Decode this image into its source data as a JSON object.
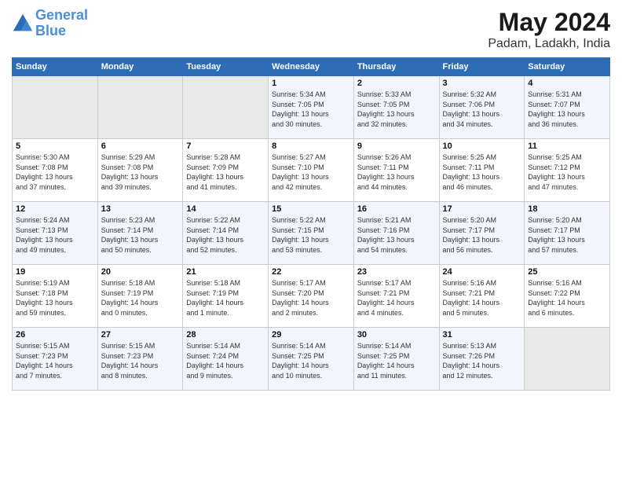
{
  "header": {
    "logo_line1": "General",
    "logo_line2": "Blue",
    "month": "May 2024",
    "location": "Padam, Ladakh, India"
  },
  "days_of_week": [
    "Sunday",
    "Monday",
    "Tuesday",
    "Wednesday",
    "Thursday",
    "Friday",
    "Saturday"
  ],
  "weeks": [
    [
      {
        "day": "",
        "info": ""
      },
      {
        "day": "",
        "info": ""
      },
      {
        "day": "",
        "info": ""
      },
      {
        "day": "1",
        "info": "Sunrise: 5:34 AM\nSunset: 7:05 PM\nDaylight: 13 hours\nand 30 minutes."
      },
      {
        "day": "2",
        "info": "Sunrise: 5:33 AM\nSunset: 7:05 PM\nDaylight: 13 hours\nand 32 minutes."
      },
      {
        "day": "3",
        "info": "Sunrise: 5:32 AM\nSunset: 7:06 PM\nDaylight: 13 hours\nand 34 minutes."
      },
      {
        "day": "4",
        "info": "Sunrise: 5:31 AM\nSunset: 7:07 PM\nDaylight: 13 hours\nand 36 minutes."
      }
    ],
    [
      {
        "day": "5",
        "info": "Sunrise: 5:30 AM\nSunset: 7:08 PM\nDaylight: 13 hours\nand 37 minutes."
      },
      {
        "day": "6",
        "info": "Sunrise: 5:29 AM\nSunset: 7:08 PM\nDaylight: 13 hours\nand 39 minutes."
      },
      {
        "day": "7",
        "info": "Sunrise: 5:28 AM\nSunset: 7:09 PM\nDaylight: 13 hours\nand 41 minutes."
      },
      {
        "day": "8",
        "info": "Sunrise: 5:27 AM\nSunset: 7:10 PM\nDaylight: 13 hours\nand 42 minutes."
      },
      {
        "day": "9",
        "info": "Sunrise: 5:26 AM\nSunset: 7:11 PM\nDaylight: 13 hours\nand 44 minutes."
      },
      {
        "day": "10",
        "info": "Sunrise: 5:25 AM\nSunset: 7:11 PM\nDaylight: 13 hours\nand 46 minutes."
      },
      {
        "day": "11",
        "info": "Sunrise: 5:25 AM\nSunset: 7:12 PM\nDaylight: 13 hours\nand 47 minutes."
      }
    ],
    [
      {
        "day": "12",
        "info": "Sunrise: 5:24 AM\nSunset: 7:13 PM\nDaylight: 13 hours\nand 49 minutes."
      },
      {
        "day": "13",
        "info": "Sunrise: 5:23 AM\nSunset: 7:14 PM\nDaylight: 13 hours\nand 50 minutes."
      },
      {
        "day": "14",
        "info": "Sunrise: 5:22 AM\nSunset: 7:14 PM\nDaylight: 13 hours\nand 52 minutes."
      },
      {
        "day": "15",
        "info": "Sunrise: 5:22 AM\nSunset: 7:15 PM\nDaylight: 13 hours\nand 53 minutes."
      },
      {
        "day": "16",
        "info": "Sunrise: 5:21 AM\nSunset: 7:16 PM\nDaylight: 13 hours\nand 54 minutes."
      },
      {
        "day": "17",
        "info": "Sunrise: 5:20 AM\nSunset: 7:17 PM\nDaylight: 13 hours\nand 56 minutes."
      },
      {
        "day": "18",
        "info": "Sunrise: 5:20 AM\nSunset: 7:17 PM\nDaylight: 13 hours\nand 57 minutes."
      }
    ],
    [
      {
        "day": "19",
        "info": "Sunrise: 5:19 AM\nSunset: 7:18 PM\nDaylight: 13 hours\nand 59 minutes."
      },
      {
        "day": "20",
        "info": "Sunrise: 5:18 AM\nSunset: 7:19 PM\nDaylight: 14 hours\nand 0 minutes."
      },
      {
        "day": "21",
        "info": "Sunrise: 5:18 AM\nSunset: 7:19 PM\nDaylight: 14 hours\nand 1 minute."
      },
      {
        "day": "22",
        "info": "Sunrise: 5:17 AM\nSunset: 7:20 PM\nDaylight: 14 hours\nand 2 minutes."
      },
      {
        "day": "23",
        "info": "Sunrise: 5:17 AM\nSunset: 7:21 PM\nDaylight: 14 hours\nand 4 minutes."
      },
      {
        "day": "24",
        "info": "Sunrise: 5:16 AM\nSunset: 7:21 PM\nDaylight: 14 hours\nand 5 minutes."
      },
      {
        "day": "25",
        "info": "Sunrise: 5:16 AM\nSunset: 7:22 PM\nDaylight: 14 hours\nand 6 minutes."
      }
    ],
    [
      {
        "day": "26",
        "info": "Sunrise: 5:15 AM\nSunset: 7:23 PM\nDaylight: 14 hours\nand 7 minutes."
      },
      {
        "day": "27",
        "info": "Sunrise: 5:15 AM\nSunset: 7:23 PM\nDaylight: 14 hours\nand 8 minutes."
      },
      {
        "day": "28",
        "info": "Sunrise: 5:14 AM\nSunset: 7:24 PM\nDaylight: 14 hours\nand 9 minutes."
      },
      {
        "day": "29",
        "info": "Sunrise: 5:14 AM\nSunset: 7:25 PM\nDaylight: 14 hours\nand 10 minutes."
      },
      {
        "day": "30",
        "info": "Sunrise: 5:14 AM\nSunset: 7:25 PM\nDaylight: 14 hours\nand 11 minutes."
      },
      {
        "day": "31",
        "info": "Sunrise: 5:13 AM\nSunset: 7:26 PM\nDaylight: 14 hours\nand 12 minutes."
      },
      {
        "day": "",
        "info": ""
      }
    ]
  ]
}
